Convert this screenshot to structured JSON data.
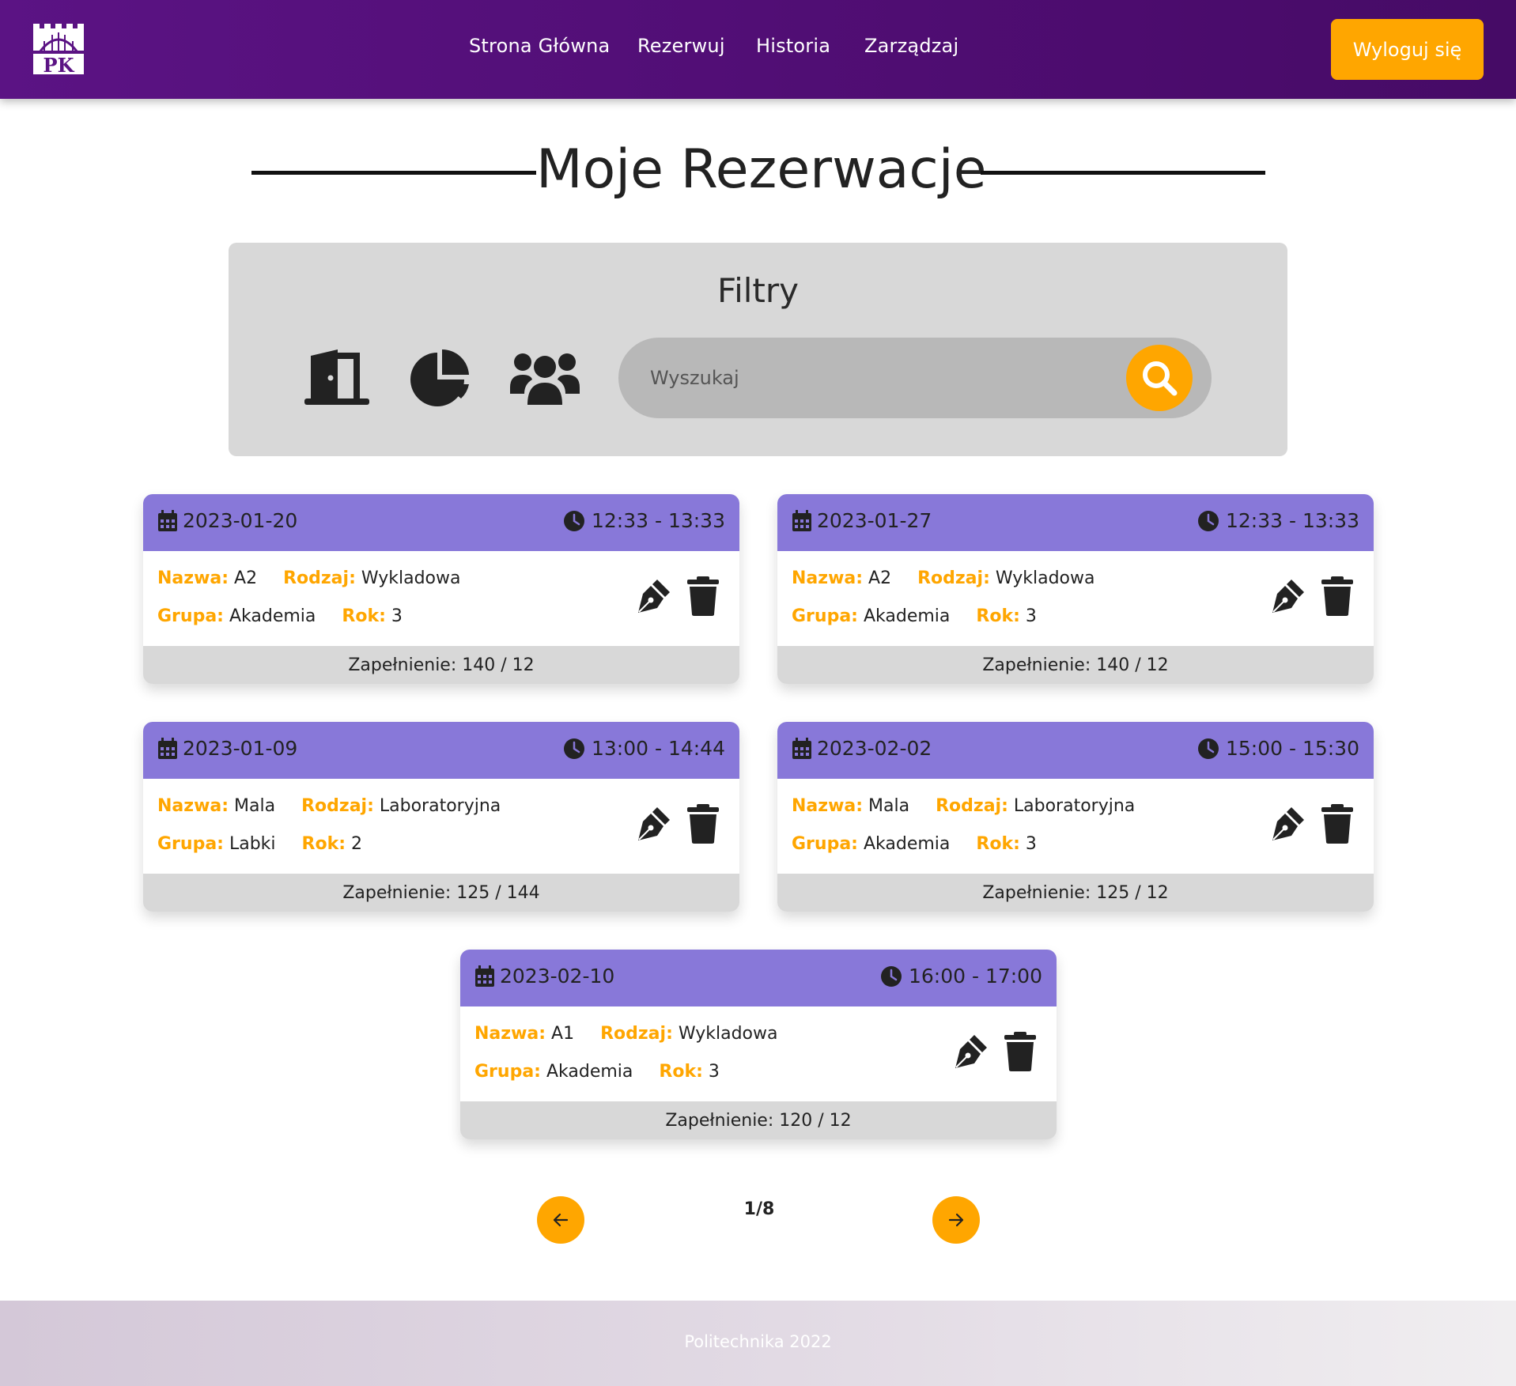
{
  "nav": {
    "logo_text": "PK",
    "items": [
      {
        "label": "Strona Główna"
      },
      {
        "label": "Rezerwuj"
      },
      {
        "label": "Historia"
      },
      {
        "label": "Zarządzaj"
      }
    ],
    "logout_label": "Wyloguj się"
  },
  "page_title": "Moje Rezerwacje",
  "filters": {
    "title": "Filtry",
    "icons": [
      "door-icon",
      "pie-chart-icon",
      "users-icon"
    ],
    "search_placeholder": "Wyszukaj"
  },
  "labels": {
    "name": "Nazwa:",
    "type": "Rodzaj:",
    "group": "Grupa:",
    "year": "Rok:"
  },
  "reservations": [
    {
      "date": "2023-01-20",
      "time": "12:33 - 13:33",
      "name": "A2",
      "type": "Wykladowa",
      "group": "Akademia",
      "year": "3",
      "fill": "Zapełnienie: 140 / 12"
    },
    {
      "date": "2023-01-27",
      "time": "12:33 - 13:33",
      "name": "A2",
      "type": "Wykladowa",
      "group": "Akademia",
      "year": "3",
      "fill": "Zapełnienie: 140 / 12"
    },
    {
      "date": "2023-01-09",
      "time": "13:00 - 14:44",
      "name": "Mala",
      "type": "Laboratoryjna",
      "group": "Labki",
      "year": "2",
      "fill": "Zapełnienie: 125 / 144"
    },
    {
      "date": "2023-02-02",
      "time": "15:00 - 15:30",
      "name": "Mala",
      "type": "Laboratoryjna",
      "group": "Akademia",
      "year": "3",
      "fill": "Zapełnienie: 125 / 12"
    },
    {
      "date": "2023-02-10",
      "time": "16:00 - 17:00",
      "name": "A1",
      "type": "Wykladowa",
      "group": "Akademia",
      "year": "3",
      "fill": "Zapełnienie: 120 / 12"
    }
  ],
  "pagination": {
    "label": "1/8"
  },
  "footer": {
    "text": "Politechnika 2022"
  },
  "colors": {
    "header": "#5b1384",
    "accent": "#ffa600",
    "card_header": "#8878d9",
    "panel": "#d8d8d8"
  }
}
